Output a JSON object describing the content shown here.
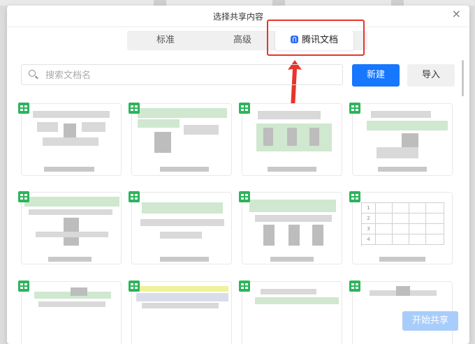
{
  "dialog": {
    "title": "选择共享内容",
    "close_symbol": "×"
  },
  "tabs": [
    {
      "label": "标准"
    },
    {
      "label": "高级"
    },
    {
      "label": "腾讯文档",
      "icon": "tencent-docs-icon"
    }
  ],
  "search": {
    "placeholder": "搜索文档名",
    "value": ""
  },
  "buttons": {
    "new": "新建",
    "import": "导入",
    "share": "开始共享"
  },
  "template_table": {
    "row_numbers": [
      "1",
      "2",
      "3",
      "4"
    ]
  },
  "colors": {
    "accent": "#1677ff",
    "highlight": "#e8342a",
    "sheet_icon": "#2db45c",
    "share_disabled": "#a8cdfb"
  }
}
